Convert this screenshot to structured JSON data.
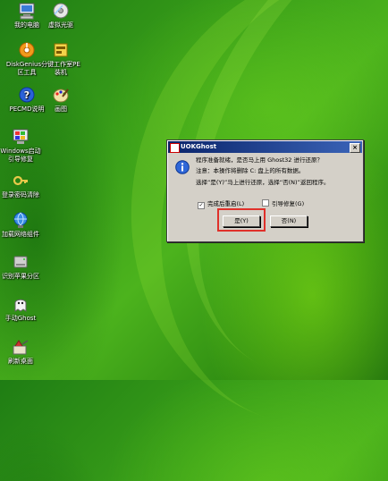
{
  "desktop": {
    "icons": [
      {
        "label": "我的电脑",
        "icon": "computer-icon"
      },
      {
        "label": "虚拟光驱",
        "icon": "virtual-drive-icon"
      },
      {
        "label": "DiskGenius分\n区工具",
        "icon": "diskgenius-icon"
      },
      {
        "label": "一键工作室PE\n装机",
        "icon": "pe-install-icon"
      },
      {
        "label": "PECMD说明",
        "icon": "help-icon"
      },
      {
        "label": "画图",
        "icon": "paint-icon"
      },
      {
        "label": "Windows启动\n引导修复",
        "icon": "boot-repair-icon"
      },
      {
        "label": "登录密码清除",
        "icon": "password-clear-icon"
      },
      {
        "label": "加载网络组件",
        "icon": "network-icon"
      },
      {
        "label": "识别苹果分区",
        "icon": "apple-partition-icon"
      },
      {
        "label": "手动Ghost",
        "icon": "ghost-icon"
      },
      {
        "label": "刷新桌面",
        "icon": "refresh-desktop-icon"
      }
    ]
  },
  "dialog": {
    "title": "UOKGhost",
    "close_label": "×",
    "line1": "程序准备就绪，是否马上用 Ghost32 进行还原？",
    "line2": "注意：本操作将删除 C: 盘上的所有数据。",
    "line3": "选择“是(Y)”马上进行还原，选择“否(N)”返回程序。",
    "checkbox_restart": {
      "label": "完成后重启(L)",
      "checked": true
    },
    "checkbox_boot_repair": {
      "label": "引导修复(G)",
      "checked": false
    },
    "yes_label": "是(Y)",
    "no_label": "否(N)",
    "check_mark": "✓"
  },
  "colors": {
    "highlight": "#e0302a",
    "titlebar": "#0a246a"
  }
}
